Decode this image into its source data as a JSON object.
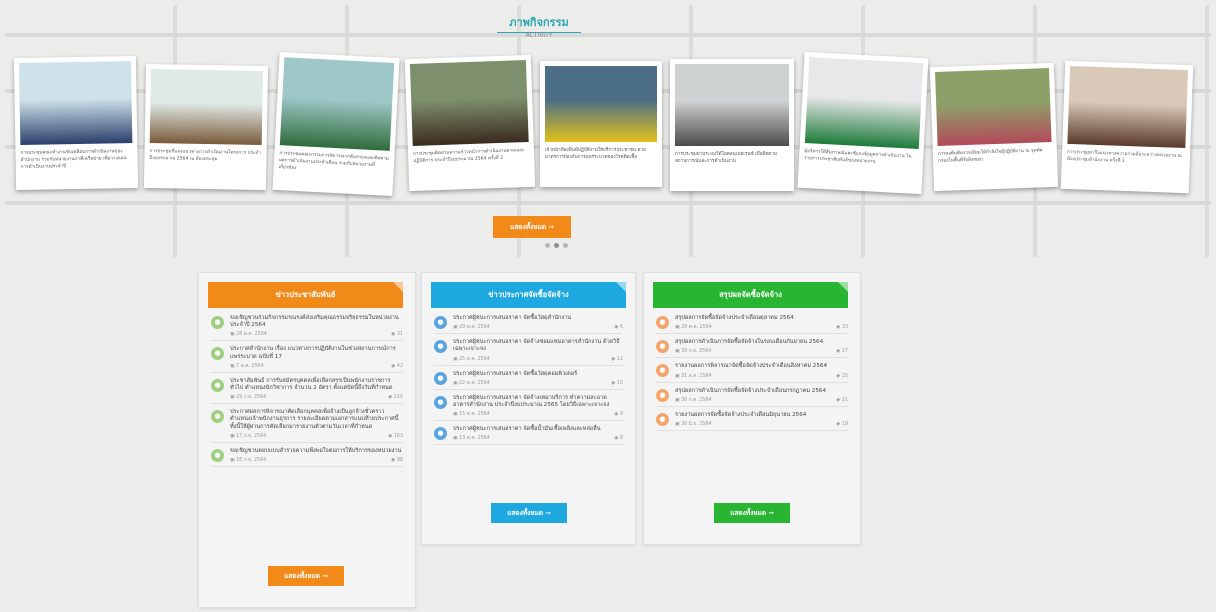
{
  "gallery": {
    "title": "ภาพกิจกรรม",
    "subtitle": "ACTIVITY",
    "more_label": "แสดงทั้งหมด →",
    "photos": [
      {
        "caption": "การประชุมคณะทำงานขับเคลื่อนการดำเนินงานของสำนักงาน ร่วมกับหน่วยงานภาคีเครือข่าย เพื่อวางแผนการดำเนินงานประจำปี",
        "colors": [
          "#cfe2ea",
          "#2a3f6b"
        ]
      },
      {
        "caption": "การประชุมชี้แจงแนวทางการดำเนินงานโครงการ ประจำปีงบประมาณ 2564 ณ ห้องประชุม",
        "colors": [
          "#dfe9e6",
          "#7a5a3a"
        ]
      },
      {
        "caption": "การประชุมคณะกรรมการพิจารณากลั่นกรองและติดตามผลการดำเนินงานประจำเดือน ร่วมกับหน่วยงานที่เกี่ยวข้อง",
        "colors": [
          "#9ec7c8",
          "#2f6b3a"
        ]
      },
      {
        "caption": "การประชุมติดตามความก้าวหน้าการดำเนินงานตามแผนปฏิบัติการ ประจำปีงบประมาณ 2564 ครั้งที่ 2",
        "colors": [
          "#7e8f6d",
          "#3a2a1e"
        ]
      },
      {
        "caption": "เจ้าหน้าที่ลงพื้นที่ปฏิบัติงานให้บริการประชาชน ตามมาตรการป้องกันการแพร่ระบาดของโรคติดเชื้อ",
        "colors": [
          "#4c6f86",
          "#e2c21a"
        ]
      },
      {
        "caption": "การประชุมผ่านระบบวิดีโอคอนเฟอเรนซ์ เพื่อติดตามสถานการณ์และการดำเนินงาน",
        "colors": [
          "#cfd2d2",
          "#4a4a4a"
        ]
      },
      {
        "caption": "ผู้บริหารให้สัมภาษณ์และชี้แจงข้อมูลการดำเนินงาน ในรายการประชาสัมพันธ์ของหน่วยงาน",
        "colors": [
          "#e8e8ea",
          "#1d7a3a"
        ]
      },
      {
        "caption": "การลงพื้นที่ตรวจเยี่ยมให้กำลังใจผู้ปฏิบัติงาน ณ จุดคัดกรองในพื้นที่รับผิดชอบ",
        "colors": [
          "#8ea069",
          "#b24a5a"
        ]
      },
      {
        "caption": "การประชุมหารือแนวทางความร่วมมือระหว่างหน่วยงาน ณ ห้องประชุมสำนักงาน ครั้งที่ 1",
        "colors": [
          "#d9c9b9",
          "#5a3a2a"
        ]
      }
    ]
  },
  "panels": [
    {
      "title": "ข่าวประชาสัมพันธ์",
      "more_label": "แสดงทั้งหมด →",
      "items": [
        {
          "title": "ขอเชิญชวนร่วมกิจกรรมรณรงค์ส่งเสริมคุณธรรมจริยธรรมในหน่วยงาน ประจำปี 2564",
          "date": "28 ต.ค. 2564",
          "views": "31"
        },
        {
          "title": "ประกาศสำนักงาน เรื่อง แนวทางการปฏิบัติงานในช่วงสถานการณ์การแพร่ระบาด ฉบับที่ 17",
          "date": "7 ต.ค. 2564",
          "views": "42"
        },
        {
          "title": "ประชาสัมพันธ์ การรับสมัครบุคคลเพื่อเลือกสรรเป็นพนักงานราชการทั่วไป ตำแหน่งนักวิชาการ จำนวน 2 อัตรา ตั้งแต่บัดนี้ถึงวันที่กำหนด",
          "date": "29 ก.ย. 2564",
          "views": "215"
        },
        {
          "title": "ประกาศผลการพิจารณาคัดเลือกบุคคลเพื่อจ้างเป็นลูกจ้างชั่วคราว ตำแหน่งเจ้าพนักงานธุรการ รายละเอียดตามเอกสารแนบท้ายประกาศนี้ ทั้งนี้ให้ผู้ผ่านการคัดเลือกมารายงานตัวตามวันเวลาที่กำหนด",
          "date": "17 ก.ย. 2564",
          "views": "163"
        },
        {
          "title": "ขอเชิญชวนตอบแบบสำรวจความพึงพอใจต่อการให้บริการของหน่วยงาน",
          "date": "16 ก.ย. 2564",
          "views": "98"
        }
      ]
    },
    {
      "title": "ข่าวประกาศจัดซื้อจัดจ้าง",
      "more_label": "แสดงทั้งหมด →",
      "items": [
        {
          "title": "ประกาศผู้ชนะการเสนอราคา จัดซื้อวัสดุสำนักงาน",
          "date": "29 ต.ค. 2564",
          "views": "6"
        },
        {
          "title": "ประกาศผู้ชนะการเสนอราคา จัดจ้างซ่อมแซมอาคารสำนักงาน ด้วยวิธีเฉพาะเจาะจง",
          "date": "25 ต.ค. 2564",
          "views": "12"
        },
        {
          "title": "ประกาศผู้ชนะการเสนอราคา จัดซื้อวัสดุคอมพิวเตอร์",
          "date": "22 ต.ค. 2564",
          "views": "10"
        },
        {
          "title": "ประกาศผู้ชนะการเสนอราคา จัดจ้างเหมาบริการ ทำความสะอาดอาคารสำนักงาน ประจำปีงบประมาณ 2565 โดยวิธีเฉพาะเจาะจง",
          "date": "15 ต.ค. 2564",
          "views": "9"
        },
        {
          "title": "ประกาศผู้ชนะการเสนอราคา จัดซื้อน้ำมันเชื้อเพลิงและหล่อลื่น",
          "date": "13 ต.ค. 2564",
          "views": "8"
        }
      ]
    },
    {
      "title": "สรุปผลจัดซื้อจัดจ้าง",
      "more_label": "แสดงทั้งหมด →",
      "items": [
        {
          "title": "สรุปผลการจัดซื้อจัดจ้างประจำเดือนตุลาคม 2564",
          "date": "29 ต.ค. 2564",
          "views": "33"
        },
        {
          "title": "สรุปผลการดำเนินการจัดซื้อจัดจ้างในรอบเดือนกันยายน 2564",
          "date": "30 ก.ย. 2564",
          "views": "27"
        },
        {
          "title": "รายงานผลการพิจารณาจัดซื้อจัดจ้างประจำเดือนสิงหาคม 2564",
          "date": "31 ส.ค. 2564",
          "views": "25"
        },
        {
          "title": "สรุปผลการดำเนินการจัดซื้อจัดจ้างประจำเดือนกรกฎาคม 2564",
          "date": "30 ก.ค. 2564",
          "views": "21"
        },
        {
          "title": "รายงานผลการจัดซื้อจัดจ้างประจำเดือนมิถุนายน 2564",
          "date": "30 มิ.ย. 2564",
          "views": "19"
        }
      ]
    }
  ]
}
